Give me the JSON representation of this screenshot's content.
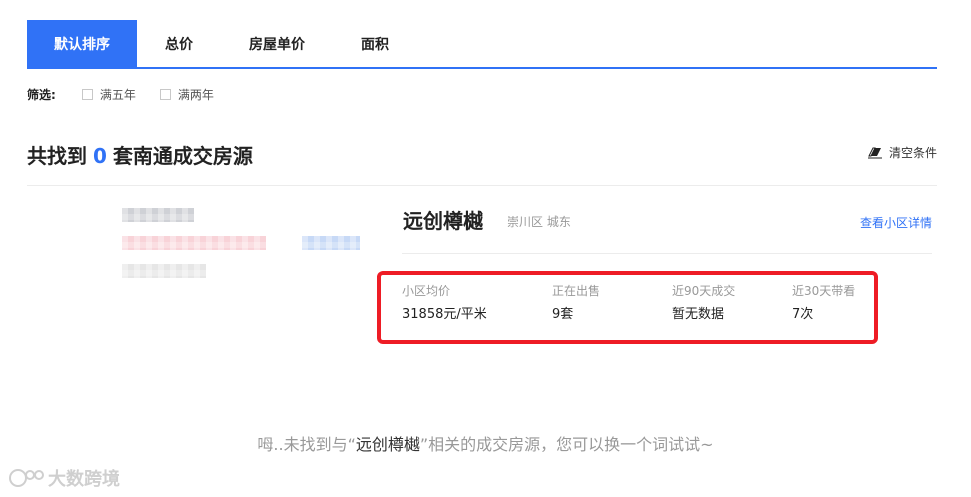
{
  "tabs": [
    {
      "label": "默认排序",
      "active": true
    },
    {
      "label": "总价",
      "active": false
    },
    {
      "label": "房屋单价",
      "active": false
    },
    {
      "label": "面积",
      "active": false
    }
  ],
  "filters": {
    "label": "筛选:",
    "options": [
      "满五年",
      "满两年"
    ]
  },
  "result": {
    "prefix": "共找到",
    "count": "0",
    "suffix": "套南通成交房源",
    "clear_label": "清空条件"
  },
  "community": {
    "name": "远创樽樾",
    "location": "崇川区 城东",
    "detail_link": "查看小区详情",
    "stats": [
      {
        "label": "小区均价",
        "value": "31858元/平米"
      },
      {
        "label": "正在出售",
        "value": "9套"
      },
      {
        "label": "近90天成交",
        "value": "暂无数据"
      },
      {
        "label": "近30天带看",
        "value": "7次"
      }
    ]
  },
  "no_result": {
    "before": "呣..未找到与“",
    "keyword": "远创樽樾",
    "after": "”相关的成交房源，您可以换一个词试试~"
  },
  "watermark": "大数跨境",
  "colors": {
    "accent": "#3072f6",
    "highlight_box": "#ee1c25"
  },
  "icons": {
    "clear": "eraser-icon",
    "watermark": "logo-icon"
  }
}
